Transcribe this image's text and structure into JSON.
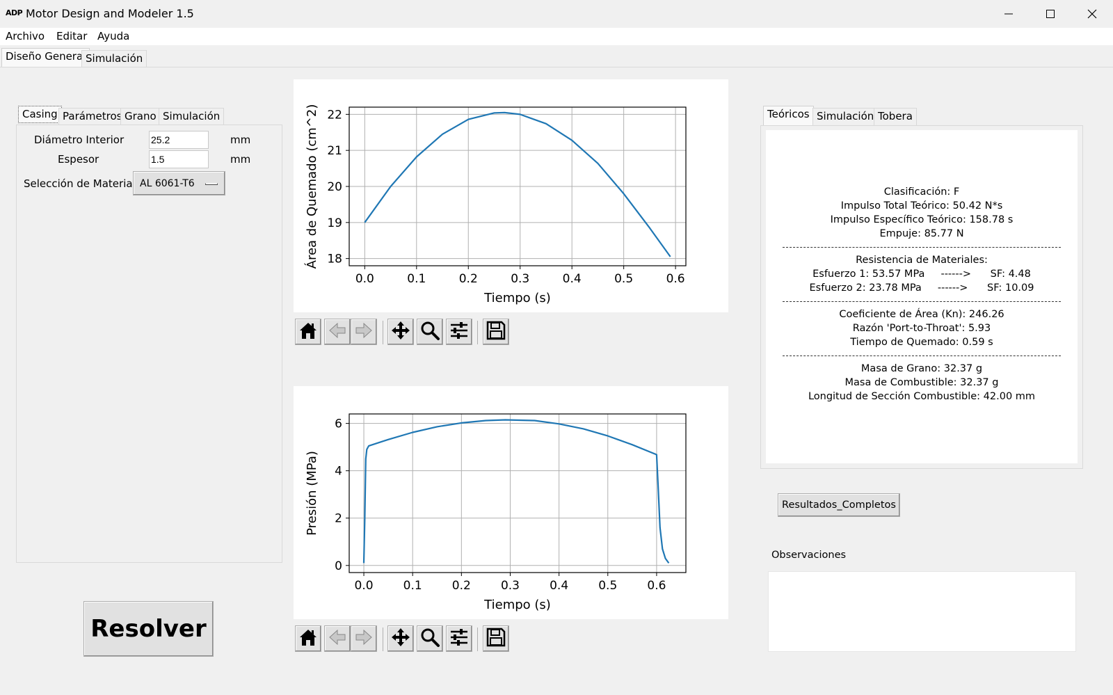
{
  "window": {
    "logo": "ADP",
    "title": "Motor Design and Modeler 1.5"
  },
  "menu": [
    "Archivo",
    "Editar",
    "Ayuda"
  ],
  "main_tabs": [
    "Diseño General",
    "Simulación"
  ],
  "left_tabs": [
    "Casing",
    "Parámetros",
    "Grano",
    "Simulación"
  ],
  "casing": {
    "inner_diameter_label": "Diámetro Interior",
    "inner_diameter_value": "25.2",
    "inner_diameter_unit": "mm",
    "thickness_label": "Espesor",
    "thickness_value": "1.5",
    "thickness_unit": "mm",
    "material_label": "Selección de Material",
    "material_value": "AL 6061-T6"
  },
  "solve_button": "Resolver",
  "right_tabs": [
    "Teóricos",
    "Simulación",
    "Tobera"
  ],
  "results": {
    "block1": [
      "Clasificación: F",
      "Impulso Total Teórico: 50.42 N*s",
      "Impulso Específico Teórico: 158.78 s",
      "Empuje: 85.77 N"
    ],
    "block2": [
      "Resistencia de Materiales:",
      "Esfuerzo 1: 53.57 MPa     ------>      SF: 4.48",
      "Esfuerzo 2: 23.78 MPa     ------>      SF: 10.09"
    ],
    "block3": [
      "Coeficiente de Área (Kn): 246.26",
      "Razón 'Port-to-Throat': 5.93",
      "Tiempo de Quemado: 0.59 s"
    ],
    "block4": [
      "Masa de Grano: 32.37 g",
      "Masa de Combustible: 32.37 g",
      "Longitud de Sección Combustible: 42.00 mm"
    ]
  },
  "full_results_button": "Resultados_Completos",
  "observations_label": "Observaciones",
  "toolbar_icons": [
    "home-icon",
    "back-arrow-icon",
    "forward-arrow-icon",
    "pan-icon",
    "zoom-icon",
    "configure-subplots-icon",
    "save-icon"
  ],
  "colors": {
    "line": "#1f77b4",
    "grid": "#b0b0b0"
  },
  "chart_data": [
    {
      "type": "line",
      "xlabel": "Tiempo (s)",
      "ylabel": "Área de Quemado (cm^2)",
      "xlim": [
        -0.03,
        0.62
      ],
      "ylim": [
        17.8,
        22.2
      ],
      "xticks": [
        "0.0",
        "0.1",
        "0.2",
        "0.3",
        "0.4",
        "0.5",
        "0.6"
      ],
      "yticks": [
        "18",
        "19",
        "20",
        "21",
        "22"
      ],
      "grid": true,
      "series": [
        {
          "x": [
            0.0,
            0.05,
            0.1,
            0.15,
            0.2,
            0.25,
            0.27,
            0.3,
            0.35,
            0.4,
            0.45,
            0.5,
            0.55,
            0.59
          ],
          "y": [
            19.0,
            20.0,
            20.82,
            21.45,
            21.86,
            22.04,
            22.05,
            22.0,
            21.74,
            21.28,
            20.64,
            19.8,
            18.85,
            18.05
          ]
        }
      ]
    },
    {
      "type": "line",
      "xlabel": "Tiempo (s)",
      "ylabel": "Presión (MPa)",
      "xlim": [
        -0.03,
        0.66
      ],
      "ylim": [
        -0.3,
        6.4
      ],
      "xticks": [
        "0.0",
        "0.1",
        "0.2",
        "0.3",
        "0.4",
        "0.5",
        "0.6"
      ],
      "yticks": [
        "0",
        "2",
        "4",
        "6"
      ],
      "grid": true,
      "series": [
        {
          "x": [
            0.0,
            0.002,
            0.004,
            0.006,
            0.01,
            0.05,
            0.1,
            0.15,
            0.2,
            0.25,
            0.29,
            0.35,
            0.4,
            0.45,
            0.5,
            0.55,
            0.6,
            0.603,
            0.607,
            0.612,
            0.618,
            0.625
          ],
          "y": [
            0.1,
            2.0,
            4.5,
            4.9,
            5.05,
            5.32,
            5.62,
            5.86,
            6.02,
            6.12,
            6.15,
            6.12,
            5.98,
            5.77,
            5.47,
            5.1,
            4.68,
            3.4,
            1.6,
            0.7,
            0.3,
            0.1
          ]
        }
      ]
    }
  ]
}
